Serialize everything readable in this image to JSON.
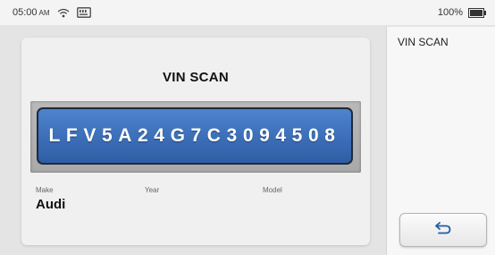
{
  "status_bar": {
    "time": "05:00",
    "ampm": "AM",
    "battery": "100%",
    "battery_level": 1.0
  },
  "main": {
    "title": "VIN SCAN",
    "vin": "LFV5A24G7C3094508",
    "fields": {
      "make_label": "Make",
      "make_value": "Audi",
      "year_label": "Year",
      "year_value": "",
      "model_label": "Model",
      "model_value": ""
    }
  },
  "side_panel": {
    "title": "VIN SCAN",
    "back_icon": "back-arrow-icon"
  },
  "colors": {
    "vin_box": "#3e72bc",
    "vin_frame": "#b0b0b0",
    "background": "#e4e4e4"
  }
}
